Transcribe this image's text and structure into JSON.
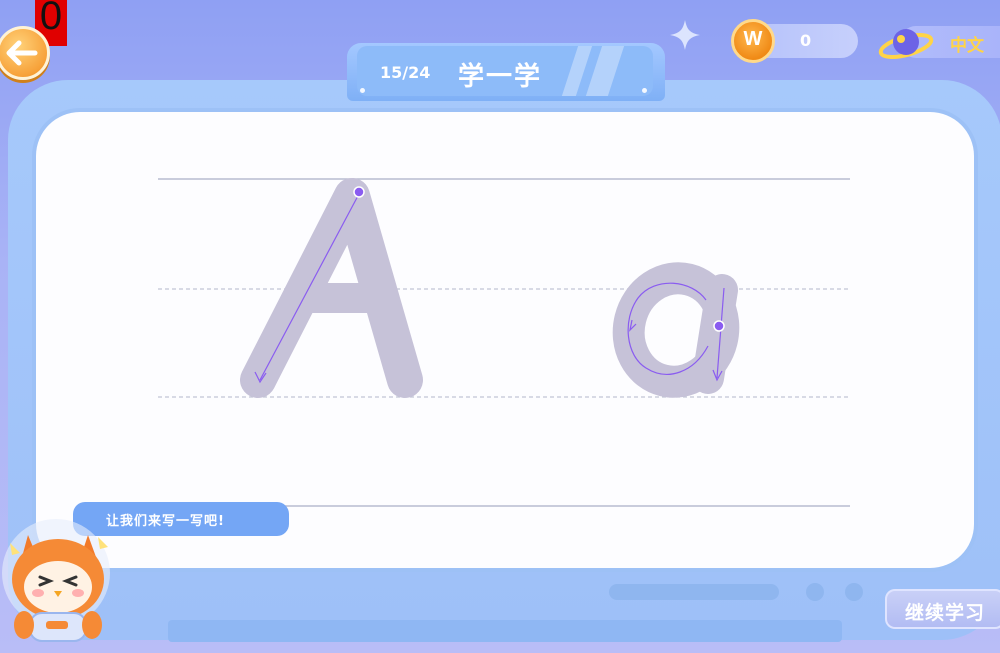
{
  "debug_counter": "0",
  "header": {
    "progress": "15/24",
    "title": "学一学",
    "coin_icon_letter": "W",
    "coin_count": "0",
    "language_label": "中文"
  },
  "lesson": {
    "uppercase_letter": "A",
    "lowercase_letter": "a"
  },
  "mascot": {
    "speech": "让我们来写一写吧!"
  },
  "actions": {
    "continue_label": "继续学习"
  },
  "colors": {
    "background": "#a9b3f6",
    "board": "#9dc1f6",
    "paper": "#fdfdff",
    "letter_fill": "#c6c2d8",
    "stroke_guide": "#8a5cf0",
    "coin": "#f08a16",
    "language_text": "#ffd447"
  },
  "icons": [
    "back-arrow-icon",
    "sparkle-icon",
    "coin-icon",
    "planet-icon",
    "owl-mascot"
  ]
}
